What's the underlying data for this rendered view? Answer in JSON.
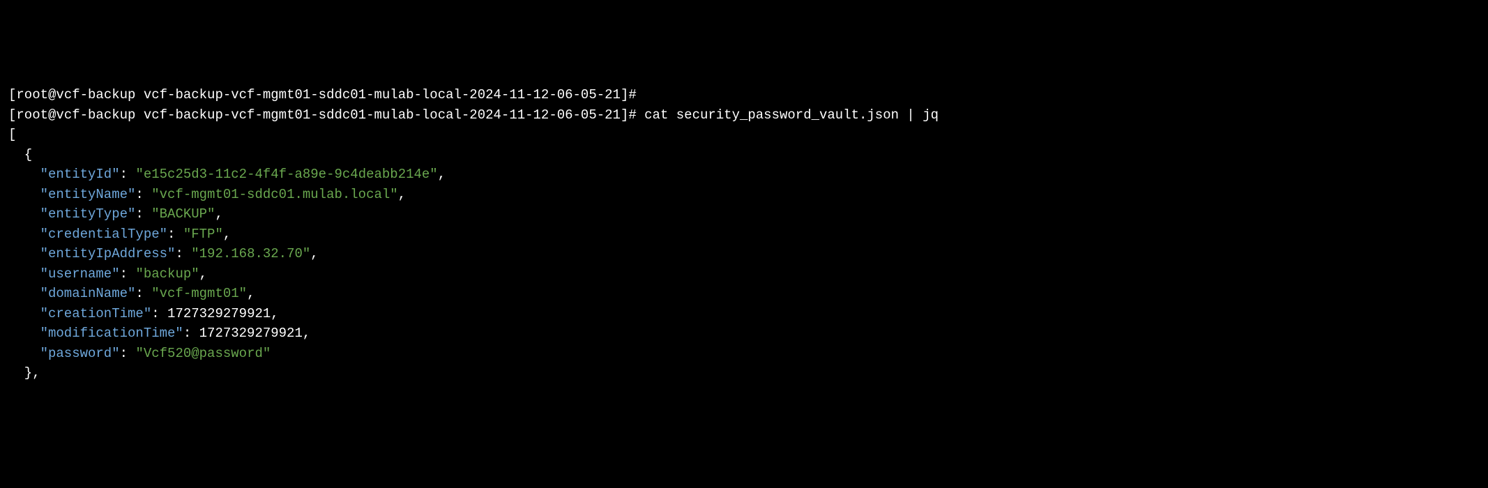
{
  "prompt1": "[root@vcf-backup vcf-backup-vcf-mgmt01-sddc01-mulab-local-2024-11-12-06-05-21]#",
  "prompt2": "[root@vcf-backup vcf-backup-vcf-mgmt01-sddc01-mulab-local-2024-11-12-06-05-21]#",
  "command": "cat security_password_vault.json | jq",
  "json": {
    "open_bracket": "[",
    "open_brace": "{",
    "entries": [
      {
        "key": "\"entityId\"",
        "sep": ": ",
        "value": "\"e15c25d3-11c2-4f4f-a89e-9c4deabb214e\"",
        "comma": ",",
        "type": "string"
      },
      {
        "key": "\"entityName\"",
        "sep": ": ",
        "value": "\"vcf-mgmt01-sddc01.mulab.local\"",
        "comma": ",",
        "type": "string"
      },
      {
        "key": "\"entityType\"",
        "sep": ": ",
        "value": "\"BACKUP\"",
        "comma": ",",
        "type": "string"
      },
      {
        "key": "\"credentialType\"",
        "sep": ": ",
        "value": "\"FTP\"",
        "comma": ",",
        "type": "string"
      },
      {
        "key": "\"entityIpAddress\"",
        "sep": ": ",
        "value": "\"192.168.32.70\"",
        "comma": ",",
        "type": "string"
      },
      {
        "key": "\"username\"",
        "sep": ": ",
        "value": "\"backup\"",
        "comma": ",",
        "type": "string"
      },
      {
        "key": "\"domainName\"",
        "sep": ": ",
        "value": "\"vcf-mgmt01\"",
        "comma": ",",
        "type": "string"
      },
      {
        "key": "\"creationTime\"",
        "sep": ": ",
        "value": "1727329279921",
        "comma": ",",
        "type": "number"
      },
      {
        "key": "\"modificationTime\"",
        "sep": ": ",
        "value": "1727329279921",
        "comma": ",",
        "type": "number"
      },
      {
        "key": "\"password\"",
        "sep": ": ",
        "value": "\"Vcf520@password\"",
        "comma": "",
        "type": "string"
      }
    ],
    "close_brace": "},"
  }
}
